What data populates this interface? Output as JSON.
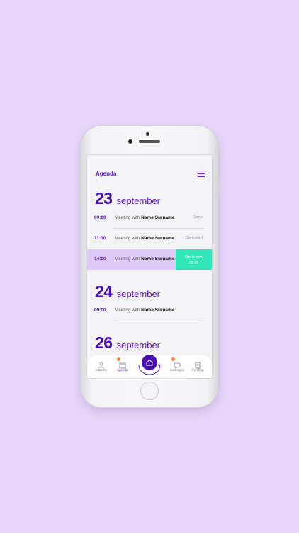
{
  "app": {
    "title": "Agenda"
  },
  "days": [
    {
      "day": "23",
      "month": "september",
      "appointments": [
        {
          "time": "09:00",
          "prefix": "Meeting with",
          "name": "Name Surname",
          "status": "Done"
        },
        {
          "time": "11:00",
          "prefix": "Meeting with",
          "name": "Name Surname",
          "status": "Canceled"
        },
        {
          "time": "14:00",
          "prefix": "Meeting with",
          "name": "Name Surname",
          "action_line1": "Starts now",
          "action_line2": "05:38"
        }
      ]
    },
    {
      "day": "24",
      "month": "september",
      "appointments": [
        {
          "time": "09:00",
          "prefix": "Meeting with",
          "name": "Name Surname"
        }
      ]
    },
    {
      "day": "26",
      "month": "september",
      "appointments": []
    }
  ],
  "tabs": [
    {
      "label": "patients",
      "icon": "person-icon"
    },
    {
      "label": "agenda",
      "icon": "calendar-icon",
      "active": true,
      "badge": true
    },
    {
      "label": "",
      "icon": "home-icon"
    },
    {
      "label": "messages",
      "icon": "chat-icon",
      "badge": true
    },
    {
      "label": "trending",
      "icon": "document-icon"
    }
  ],
  "colors": {
    "accent": "#4a0fb0",
    "action": "#2ee6b6",
    "highlight": "#dcc9f5",
    "background": "#e5d6f9",
    "badge": "#f08a3c"
  }
}
